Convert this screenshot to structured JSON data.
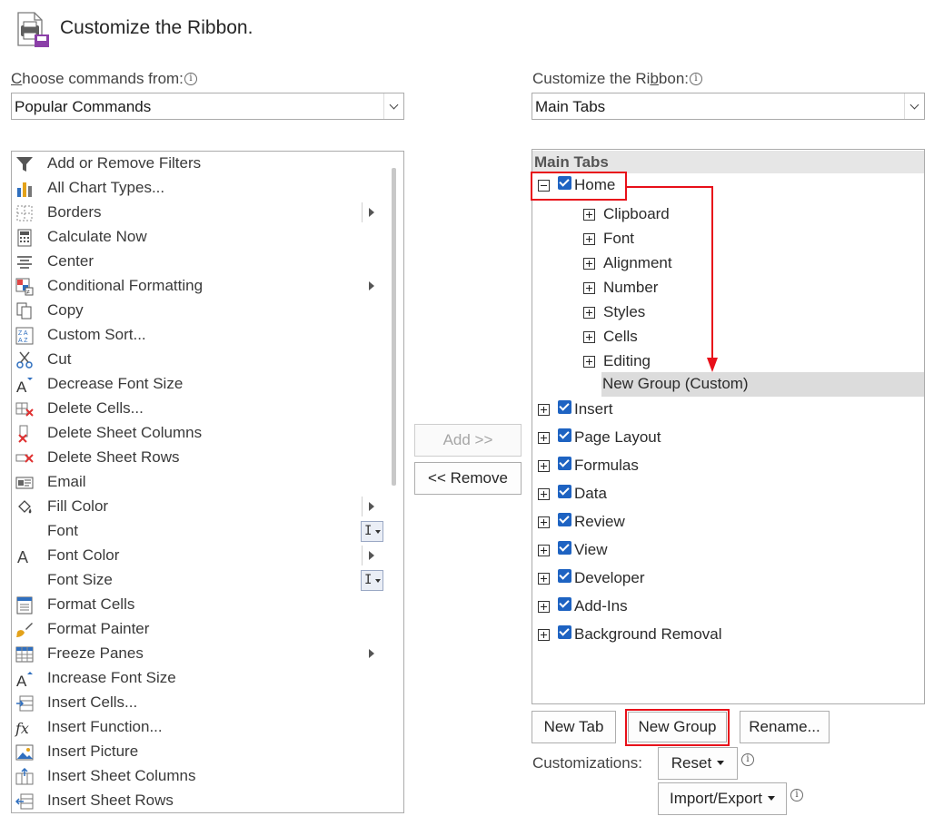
{
  "header": {
    "title": "Customize the Ribbon."
  },
  "left": {
    "label": "Choose commands from:",
    "label_key": "C",
    "label_rest": "hoose commands from:",
    "select_value": "Popular Commands"
  },
  "right": {
    "label_pre": "Customize the Ri",
    "label_key": "b",
    "label_post": "bon:",
    "select_value": "Main Tabs"
  },
  "commands": [
    {
      "label": "Add or Remove Filters",
      "icon": "filter-icon"
    },
    {
      "label": "All Chart Types...",
      "icon": "chart-icon"
    },
    {
      "label": "Borders",
      "icon": "borders-icon",
      "suffix": "submenu-sep"
    },
    {
      "label": "Calculate Now",
      "icon": "calculator-icon"
    },
    {
      "label": "Center",
      "icon": "center-align-icon"
    },
    {
      "label": "Conditional Formatting",
      "icon": "conditional-formatting-icon",
      "suffix": "submenu"
    },
    {
      "label": "Copy",
      "icon": "copy-icon"
    },
    {
      "label": "Custom Sort...",
      "icon": "sort-icon"
    },
    {
      "label": "Cut",
      "icon": "scissors-icon"
    },
    {
      "label": "Decrease Font Size",
      "icon": "decrease-font-icon"
    },
    {
      "label": "Delete Cells...",
      "icon": "delete-cells-icon"
    },
    {
      "label": "Delete Sheet Columns",
      "icon": "delete-columns-icon"
    },
    {
      "label": "Delete Sheet Rows",
      "icon": "delete-rows-icon"
    },
    {
      "label": "Email",
      "icon": "email-icon"
    },
    {
      "label": "Fill Color",
      "icon": "fill-color-icon",
      "suffix": "submenu-sep"
    },
    {
      "label": "Font",
      "icon": "",
      "suffix": "combo"
    },
    {
      "label": "Font Color",
      "icon": "font-color-icon",
      "suffix": "submenu-sep"
    },
    {
      "label": "Font Size",
      "icon": "",
      "suffix": "combo"
    },
    {
      "label": "Format Cells",
      "icon": "format-cells-icon"
    },
    {
      "label": "Format Painter",
      "icon": "paintbrush-icon"
    },
    {
      "label": "Freeze Panes",
      "icon": "freeze-panes-icon",
      "suffix": "submenu"
    },
    {
      "label": "Increase Font Size",
      "icon": "increase-font-icon"
    },
    {
      "label": "Insert Cells...",
      "icon": "insert-cells-icon"
    },
    {
      "label": "Insert Function...",
      "icon": "function-icon"
    },
    {
      "label": "Insert Picture",
      "icon": "picture-icon"
    },
    {
      "label": "Insert Sheet Columns",
      "icon": "insert-columns-icon"
    },
    {
      "label": "Insert Sheet Rows",
      "icon": "insert-rows-icon"
    }
  ],
  "middle": {
    "add_label": "Add >>",
    "remove_label": "<< Remove"
  },
  "tree": {
    "header": "Main Tabs",
    "home": "Home",
    "home_groups": [
      "Clipboard",
      "Font",
      "Alignment",
      "Number",
      "Styles",
      "Cells",
      "Editing"
    ],
    "new_group": "New Group (Custom)",
    "other_tabs": [
      "Insert",
      "Page Layout",
      "Formulas",
      "Data",
      "Review",
      "View",
      "Developer",
      "Add-Ins",
      "Background Removal"
    ]
  },
  "bottom": {
    "new_tab": "New Tab",
    "new_group": "New Group",
    "rename": "Rename...",
    "customizations_label": "Customizations:",
    "reset": "Reset",
    "import_export": "Import/Export"
  },
  "colors": {
    "accent": "#1e63c2",
    "highlight": "#e8101a"
  }
}
